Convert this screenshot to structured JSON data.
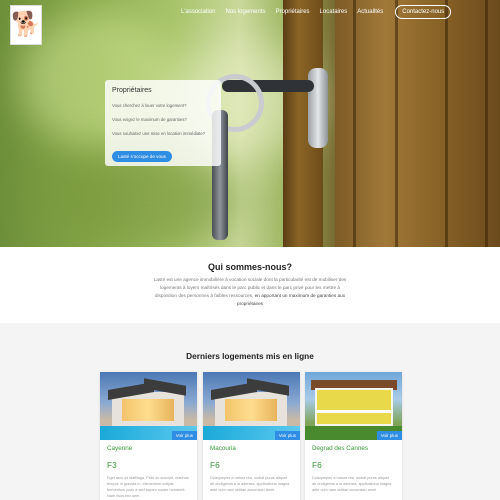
{
  "nav": {
    "items": [
      {
        "label": "L'association",
        "name": "nav-item-association"
      },
      {
        "label": "Nos logements",
        "name": "nav-item-logements"
      },
      {
        "label": "Propriétaires",
        "name": "nav-item-proprietaires"
      },
      {
        "label": "Locataires",
        "name": "nav-item-locataires"
      },
      {
        "label": "Actualités",
        "name": "nav-item-actualites"
      }
    ],
    "contact_label": "Contactez-nous"
  },
  "hero_panel": {
    "title": "Propriétaires",
    "questions": [
      "Vous cherchez à louer votre logement?",
      "Vous exigez le maximum de garanties?",
      "Vous souhaitez une mise en location immédiate?"
    ],
    "button_label": "Lasté s'occupe de vous"
  },
  "about": {
    "title": "Qui sommes-nous?",
    "text": "Lasté est une agence immobilière à vocation sociale dont la particularité est de mobiliser des logements à loyers maîtrisés dans le parc public et dans le parc privé pour les mettre à disposition des personnes à faibles ressources,",
    "highlight": "en apportant un maximum de garanties aux propriétaires"
  },
  "listings": {
    "title": "Derniers logements mis en ligne",
    "more_label": "Voir plus",
    "cards": [
      {
        "name": "Cayenne",
        "type": "F3",
        "desc": "Eget arcu sit idafillaga. Felis ac suscipit, mauhas tempor in gravida in, elementum vultpat, fermentum justo a sed sapien nostre hendrerit. Nam risus tinc sem"
      },
      {
        "name": "Macouria",
        "type": "F6",
        "desc": "Duisquepier a natura nisl, sodiat purus aliquet ab ondigemia a la adensia, applicationa magna ante cum nam oblitari accumsan amet"
      },
      {
        "name": "Degrad des Cannes",
        "type": "F6",
        "desc": "Duisquepier a natura nisl, sodiat purus aliquet ab ondigemia a la adensia, applicationa magna ante cum nam oblitari accumsan amet"
      }
    ]
  },
  "colors": {
    "accent": "#2f8de4",
    "listing_green": "#3a9a3a"
  }
}
